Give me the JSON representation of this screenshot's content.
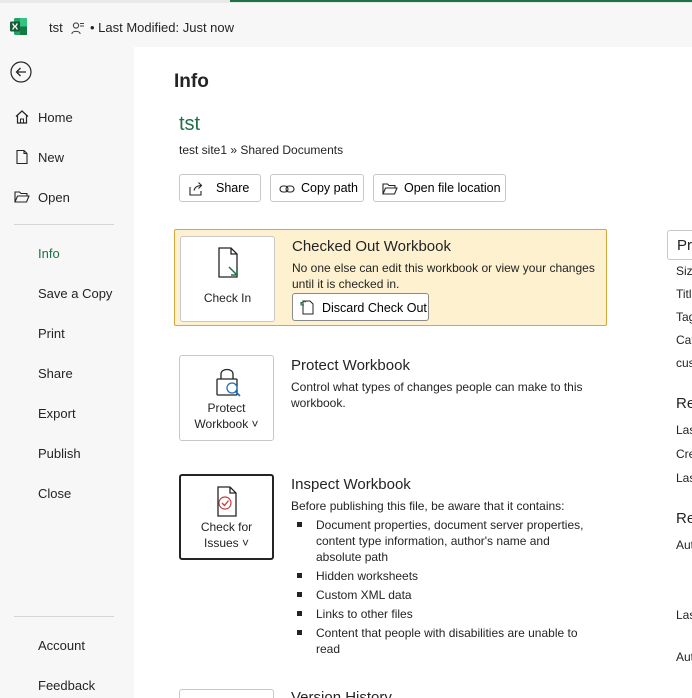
{
  "titlebar": {
    "file_name": "tst",
    "modified": "• Last Modified: Just now"
  },
  "nav": {
    "items": [
      {
        "label": "Home",
        "icon": "home-icon"
      },
      {
        "label": "New",
        "icon": "new-document-icon"
      },
      {
        "label": "Open",
        "icon": "folder-open-icon"
      },
      {
        "label": "Info",
        "active": true
      },
      {
        "label": "Save a Copy"
      },
      {
        "label": "Print"
      },
      {
        "label": "Share"
      },
      {
        "label": "Export"
      },
      {
        "label": "Publish"
      },
      {
        "label": "Close"
      },
      {
        "label": "Account"
      },
      {
        "label": "Feedback"
      }
    ]
  },
  "main": {
    "page_title": "Info",
    "file_name": "tst",
    "file_path": "test site1 » Shared Documents",
    "actions": {
      "share": "Share",
      "copy_path": "Copy path",
      "open_location": "Open file location"
    },
    "checked_out": {
      "tile_label": "Check In",
      "title": "Checked Out Workbook",
      "desc": "No one else can edit this workbook or view your changes until it is checked in.",
      "discard": "Discard Check Out"
    },
    "protect": {
      "tile_line1": "Protect",
      "tile_line2": "Workbook ˅",
      "title": "Protect Workbook",
      "desc": "Control what types of changes people can make to this workbook."
    },
    "inspect": {
      "tile_line1": "Check for",
      "tile_line2": "Issues ˅",
      "title": "Inspect Workbook",
      "desc": "Before publishing this file, be aware that it contains:",
      "bullets": [
        "Document properties, document server properties, content type information, author's name and absolute path",
        "Hidden worksheets",
        "Custom XML data",
        "Links to other files",
        "Content that people with disabilities are unable to read"
      ]
    },
    "version_history": {
      "title": "Version History"
    }
  },
  "properties": {
    "header": "Pro",
    "items": [
      "Size",
      "Title",
      "Tags",
      "Cat",
      "cus"
    ],
    "related_dates_header": "Re",
    "date_items": [
      "Las",
      "Cre",
      "Las"
    ],
    "related_people_header": "Re",
    "people_items": [
      "Aut",
      "Las"
    ],
    "extra": "Aut"
  },
  "colors": {
    "accent": "#1e7145",
    "highlight_bg": "#fdf1cf",
    "highlight_border": "#d7a73b"
  }
}
